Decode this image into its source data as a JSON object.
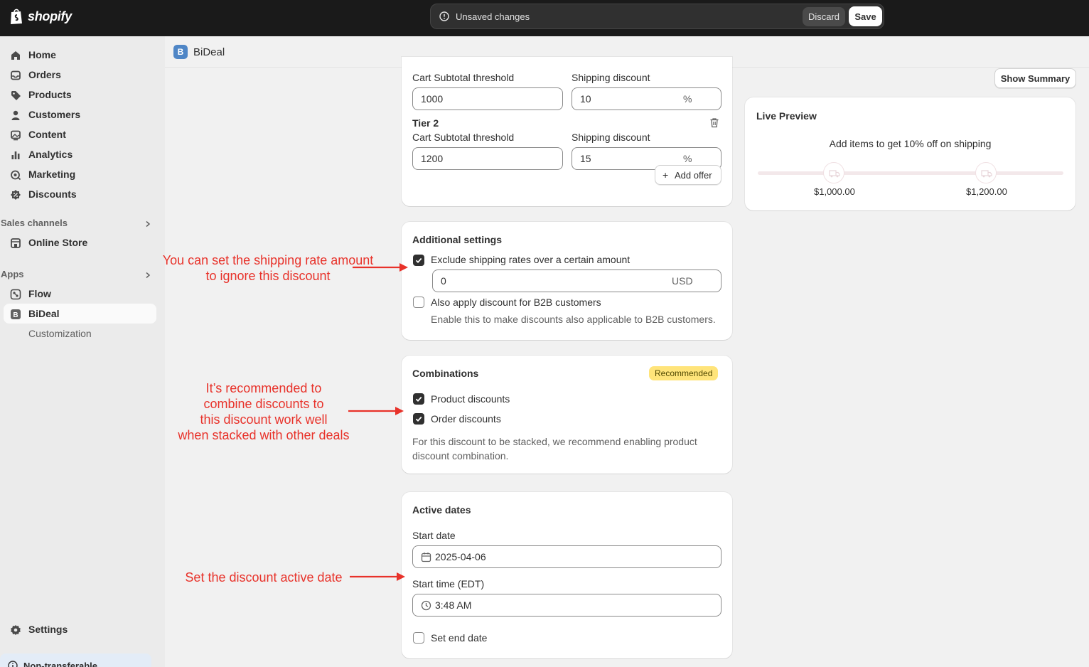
{
  "topbar": {
    "brand": "shopify",
    "unsaved_message": "Unsaved changes",
    "discard_label": "Discard",
    "save_label": "Save"
  },
  "sidebar": {
    "items": [
      {
        "label": "Home",
        "icon": "home-icon"
      },
      {
        "label": "Orders",
        "icon": "inbox-icon"
      },
      {
        "label": "Products",
        "icon": "tag-icon"
      },
      {
        "label": "Customers",
        "icon": "person-icon"
      },
      {
        "label": "Content",
        "icon": "image-icon"
      },
      {
        "label": "Analytics",
        "icon": "chart-icon"
      },
      {
        "label": "Marketing",
        "icon": "target-icon"
      },
      {
        "label": "Discounts",
        "icon": "discount-icon"
      }
    ],
    "sales_channels_header": "Sales channels",
    "online_store": "Online Store",
    "apps_header": "Apps",
    "flow": "Flow",
    "bideal": "BiDeal",
    "customization": "Customization",
    "settings": "Settings",
    "non_transferable": "Non-transferable"
  },
  "app_header": {
    "icon_letter": "B",
    "name": "BiDeal"
  },
  "tiers_card": {
    "tier1_threshold_label": "Cart Subtotal threshold",
    "tier1_discount_label": "Shipping discount",
    "tier1_threshold_value": "1000",
    "tier1_discount_value": "10",
    "percent_suffix": "%",
    "tier2_title": "Tier 2",
    "tier2_threshold_label": "Cart Subtotal threshold",
    "tier2_discount_label": "Shipping discount",
    "tier2_threshold_value": "1200",
    "tier2_discount_value": "15",
    "add_offer_label": "Add offer"
  },
  "additional_settings": {
    "title": "Additional settings",
    "exclude_label": "Exclude shipping rates over a certain amount",
    "exclude_checked": true,
    "exclude_amount": "0",
    "currency": "USD",
    "b2b_label": "Also apply discount for B2B customers",
    "b2b_checked": false,
    "b2b_help": "Enable this to make discounts also applicable to B2B customers."
  },
  "combinations": {
    "title": "Combinations",
    "badge": "Recommended",
    "product_label": "Product discounts",
    "order_label": "Order discounts",
    "help_line1": "For this discount to be stacked, we recommend enabling product",
    "help_line2": "discount combination."
  },
  "active_dates": {
    "title": "Active dates",
    "start_date_label": "Start date",
    "start_date_value": "2025-04-06",
    "start_time_label": "Start time (EDT)",
    "start_time_value": "3:48 AM",
    "end_date_label": "Set end date"
  },
  "preview": {
    "show_summary": "Show Summary",
    "title": "Live Preview",
    "message": "Add items to get 10% off on shipping",
    "milestone1": "$1,000.00",
    "milestone2": "$1,200.00",
    "progress": 0
  },
  "annotations": {
    "a1_line1": "You can set the shipping rate amount",
    "a1_line2": "to ignore this discount",
    "a2_line1": "It’s recommended to",
    "a2_line2": "combine discounts to",
    "a2_line3": "this discount work well",
    "a2_line4": "when stacked with other deals",
    "a3": "Set the discount active date",
    "color": "#e8322a"
  }
}
